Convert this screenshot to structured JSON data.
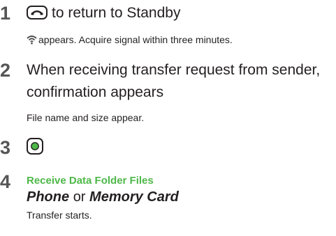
{
  "steps": [
    {
      "number": "1",
      "key_icon": "end-call-key-icon",
      "text": "to return to Standby",
      "note_icon": "ir-signal-icon",
      "note": "appears. Acquire signal within three minutes."
    },
    {
      "number": "2",
      "line1": "When receiving transfer request from sender,",
      "line2": "confirmation appears",
      "note": "File name and size appear."
    },
    {
      "number": "3",
      "key_icon": "center-select-key-icon"
    },
    {
      "number": "4",
      "menu_item": "Receive Data Folder Files",
      "option1": "Phone",
      "or": "or",
      "option2": "Memory Card",
      "note": "Transfer starts."
    }
  ],
  "colors": {
    "menu_item": "#4db848",
    "step_number": "#555555",
    "text": "#231f20"
  }
}
